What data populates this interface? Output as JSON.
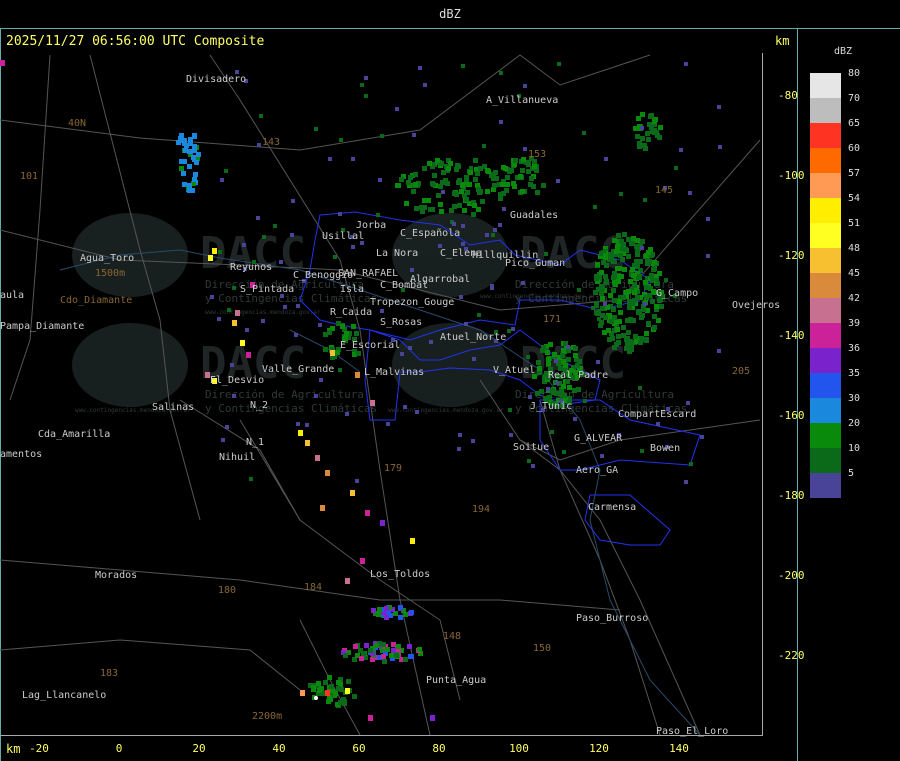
{
  "window": {
    "title": "dBZ"
  },
  "header": {
    "timestamp": "2025/11/27 06:56:00 UTC Composite",
    "km_unit": "km"
  },
  "axes": {
    "unit": "km",
    "y_ticks": [
      "-80",
      "-100",
      "-120",
      "-140",
      "-160",
      "-180",
      "-200",
      "-220"
    ],
    "x_ticks": [
      "-20",
      "0",
      "20",
      "40",
      "60",
      "80",
      "100",
      "120",
      "140"
    ]
  },
  "legend": {
    "title": "dBZ",
    "items": [
      {
        "label": "80",
        "color": "#e6e6e6"
      },
      {
        "label": "70",
        "color": "#bdbdbd"
      },
      {
        "label": "65",
        "color": "#ff3322"
      },
      {
        "label": "60",
        "color": "#ff6a00"
      },
      {
        "label": "57",
        "color": "#ff9a55"
      },
      {
        "label": "54",
        "color": "#ffee00"
      },
      {
        "label": "51",
        "color": "#ffff22"
      },
      {
        "label": "48",
        "color": "#f7c030"
      },
      {
        "label": "45",
        "color": "#d98a3a"
      },
      {
        "label": "42",
        "color": "#c77090"
      },
      {
        "label": "39",
        "color": "#cc2299"
      },
      {
        "label": "36",
        "color": "#7a22cc"
      },
      {
        "label": "35",
        "color": "#2255ee"
      },
      {
        "label": "30",
        "color": "#1a88dd"
      },
      {
        "label": "20",
        "color": "#0a8a0a"
      },
      {
        "label": "10",
        "color": "#0a6a1a"
      },
      {
        "label": "5",
        "color": "#4a4499"
      }
    ]
  },
  "watermark": {
    "brand": "DACC",
    "line1": "Dirección de Agricultura",
    "line2": "y Contingencias Climáticas",
    "url": "www.contingencias.mendoza.gov.ar"
  },
  "places": [
    "Divisadero",
    "A_Villanueva",
    "40N",
    "101",
    "143",
    "153",
    "Guadales",
    "Jorba",
    "Usillal",
    "C_Española",
    "La Nora",
    "C_Elena",
    "Hillquillin",
    "Pico_Guman",
    "Agua_Toro",
    "1500m",
    "Reyunos",
    "S_Pintada",
    "C_Benoggio",
    "SAN_RAFAEL",
    "Algarrobal",
    "C_Bombal",
    "Isla",
    "Tropezon_Gouge",
    "R_Caida",
    "S_Rosas",
    "Atuel_Norte",
    "E_Escorial",
    "V_Atuel",
    "Pampa_Diamante",
    "Cdo_Diamante",
    "El_Desvio",
    "Valle_Grande",
    "L_Malvinas",
    "N_2",
    "Salinas",
    "N_1",
    "Nihuil",
    "Cda_Amarilla",
    "amentos",
    "Soitue",
    "G_ALVEAR",
    "Aero_GA",
    "Bowen",
    "CompartEscard",
    "Carmensa",
    "Morados",
    "Los_Toldos",
    "Paso_Burroso",
    "Punta_Agua",
    "Lag_Llancanelo",
    "2200m",
    "Paso_El_Loro",
    "Ovejeros",
    "G_Campo",
    "Real_Padre",
    "J_Tunic",
    "aula",
    "145",
    "205",
    "171",
    "179",
    "184",
    "180",
    "183",
    "150",
    "148",
    "194"
  ]
}
